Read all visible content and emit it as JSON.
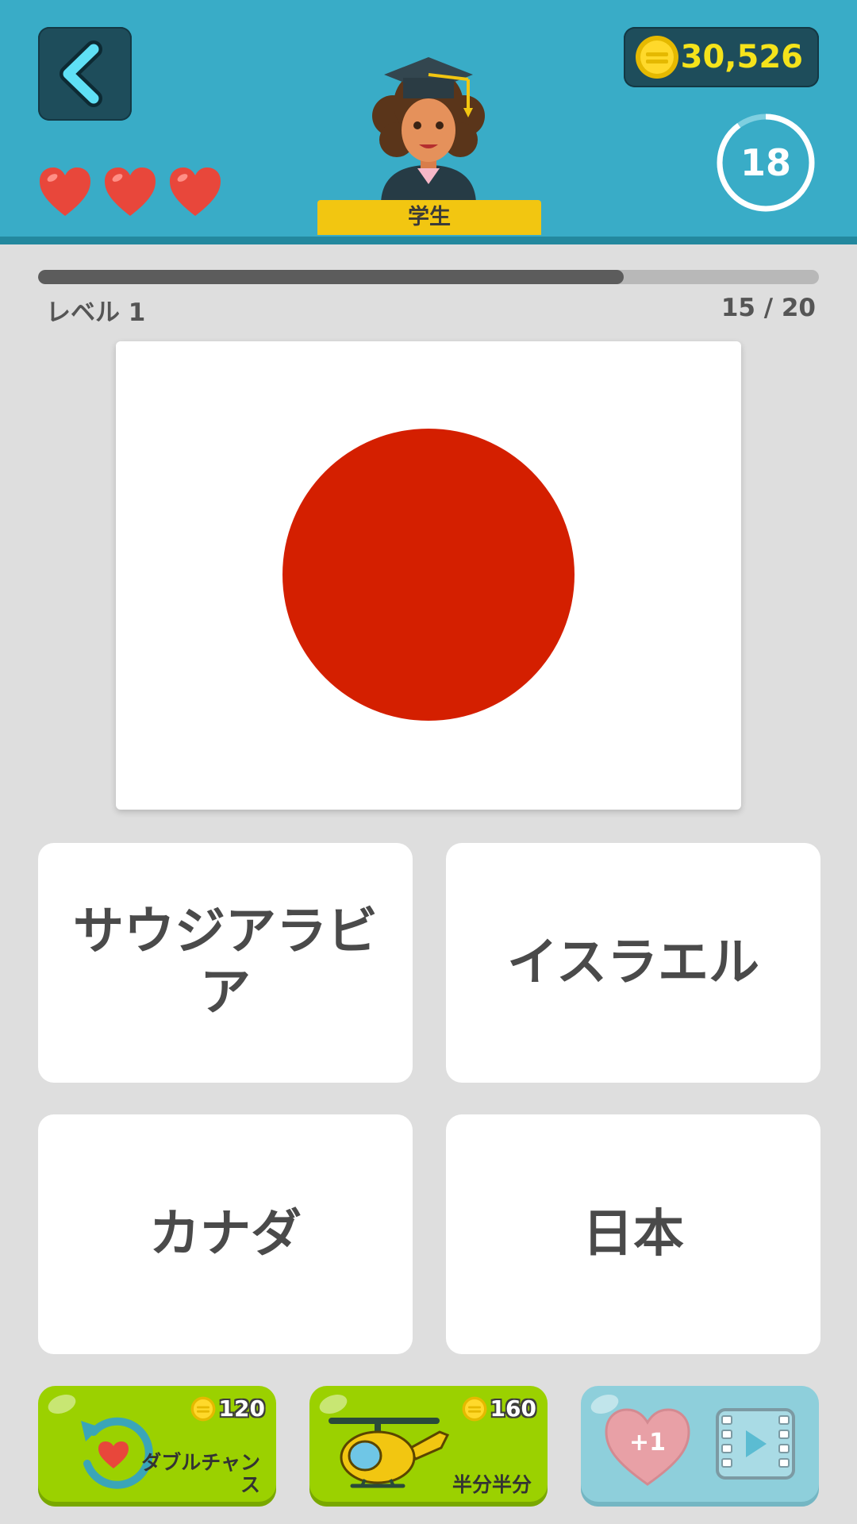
{
  "header": {
    "coins": "30,526",
    "timer": "18",
    "timer_progress": 0.9,
    "rank": "学生",
    "lives": 3
  },
  "progress": {
    "level": "レベル 1",
    "count": "15 / 20",
    "fraction": 0.75
  },
  "question": {
    "flag_icon": "japan-flag",
    "flag_colors": {
      "field": "#ffffff",
      "disc": "#d41f00"
    }
  },
  "answers": [
    {
      "label": "サウジアラビア"
    },
    {
      "label": "イスラエル"
    },
    {
      "label": "カナダ"
    },
    {
      "label": "日本"
    }
  ],
  "powerups": {
    "double_chance": {
      "cost": "120",
      "label": "ダブルチャンス"
    },
    "fifty_fifty": {
      "cost": "160",
      "label": "半分半分"
    },
    "extra_life": {
      "badge": "+1"
    }
  },
  "colors": {
    "header": "#39acc7",
    "accent_green": "#9bd100",
    "accent_blue": "#8ecfdb",
    "coin_text": "#f5e31b"
  }
}
